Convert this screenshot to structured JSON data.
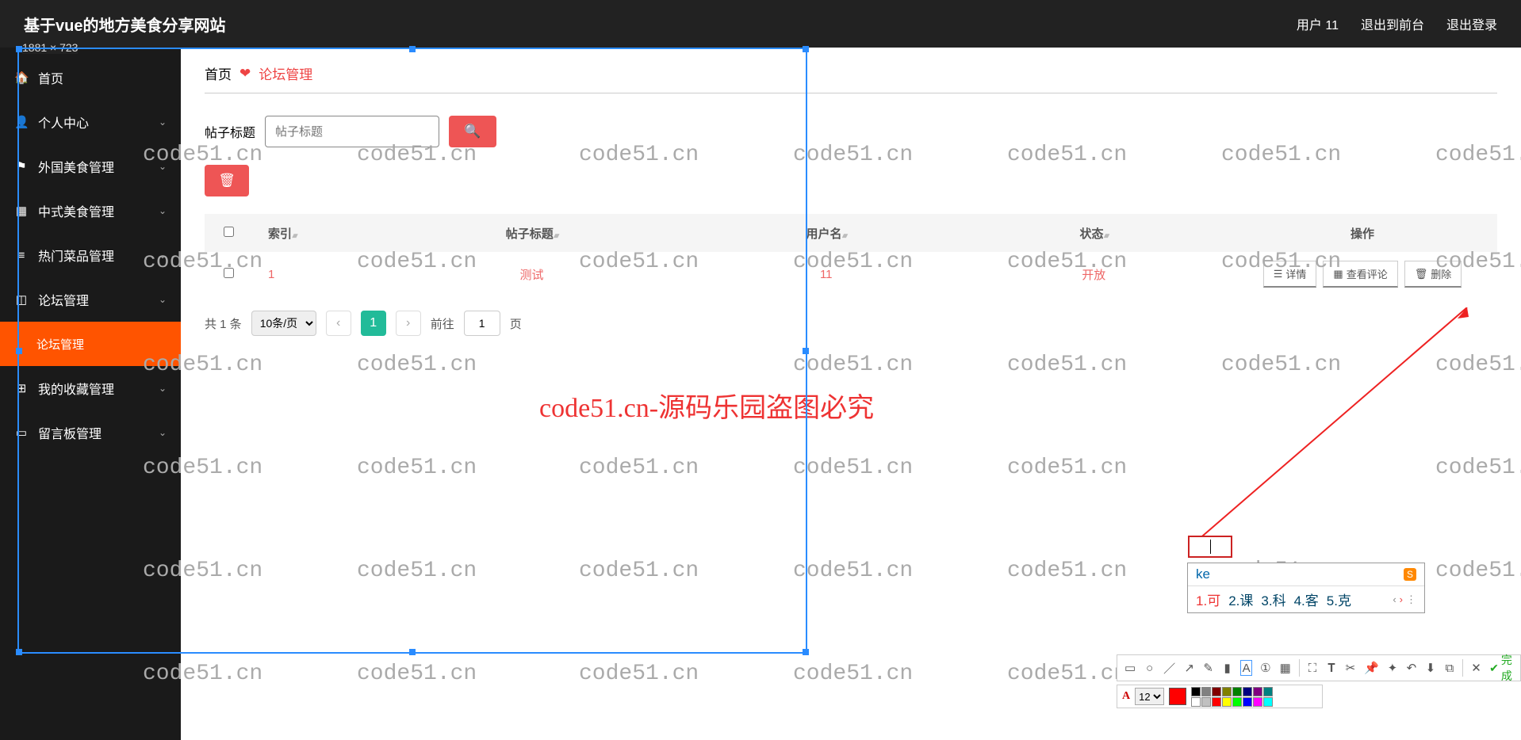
{
  "header": {
    "title": "基于vue的地方美食分享网站",
    "user_label": "用户 11",
    "to_front": "退出到前台",
    "logout": "退出登录"
  },
  "resolution": "1881 × 723",
  "sidebar": {
    "items": [
      {
        "icon": "🏠",
        "label": "首页",
        "expandable": false
      },
      {
        "icon": "👤",
        "label": "个人中心",
        "expandable": true
      },
      {
        "icon": "⚑",
        "label": "外国美食管理",
        "expandable": true
      },
      {
        "icon": "▦",
        "label": "中式美食管理",
        "expandable": true
      },
      {
        "icon": "≡",
        "label": "热门菜品管理",
        "expandable": true
      },
      {
        "icon": "◫",
        "label": "论坛管理",
        "expandable": true
      },
      {
        "icon": "⊞",
        "label": "我的收藏管理",
        "expandable": true
      },
      {
        "icon": "▭",
        "label": "留言板管理",
        "expandable": true
      }
    ],
    "active_sub": "论坛管理"
  },
  "breadcrumb": {
    "home": "首页",
    "current": "论坛管理"
  },
  "search": {
    "label": "帖子标题",
    "placeholder": "帖子标题"
  },
  "table": {
    "columns": {
      "index": "索引",
      "title": "帖子标题",
      "user": "用户名",
      "status": "状态",
      "action": "操作"
    },
    "rows": [
      {
        "index": "1",
        "title": "测试",
        "user": "11",
        "status": "开放"
      }
    ],
    "actions": {
      "detail": "详情",
      "comments": "查看评论",
      "delete": "删除"
    }
  },
  "pagination": {
    "total": "共 1 条",
    "per_page": "10条/页",
    "current": "1",
    "goto_prefix": "前往",
    "goto_value": "1",
    "goto_suffix": "页"
  },
  "ime": {
    "input": "ke",
    "candidates": [
      {
        "n": "1.",
        "w": "可"
      },
      {
        "n": "2.",
        "w": "课"
      },
      {
        "n": "3.",
        "w": "科"
      },
      {
        "n": "4.",
        "w": "客"
      },
      {
        "n": "5.",
        "w": "克"
      }
    ]
  },
  "shot_toolbar": {
    "done": "完成",
    "font_size": "12"
  },
  "watermark": "code51.cn",
  "watermark_center": "code51.cn-源码乐园盗图必究"
}
